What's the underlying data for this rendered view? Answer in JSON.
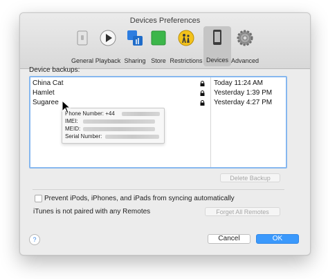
{
  "window": {
    "title": "Devices Preferences"
  },
  "toolbar": {
    "items": [
      {
        "label": "General",
        "icon": "general-icon",
        "active": false
      },
      {
        "label": "Playback",
        "icon": "play-icon",
        "active": false
      },
      {
        "label": "Sharing",
        "icon": "sharing-icon",
        "active": false
      },
      {
        "label": "Store",
        "icon": "store-icon",
        "active": false
      },
      {
        "label": "Restrictions",
        "icon": "restrictions-icon",
        "active": false
      },
      {
        "label": "Devices",
        "icon": "device-icon",
        "active": true
      },
      {
        "label": "Advanced",
        "icon": "gear-icon",
        "active": false
      }
    ]
  },
  "backups": {
    "label": "Device backups:",
    "rows": [
      {
        "name": "China Cat",
        "date": "Today 11:24 AM",
        "locked": true
      },
      {
        "name": "Hamlet",
        "date": "Yesterday 1:39 PM",
        "locked": true
      },
      {
        "name": "Sugaree",
        "date": "Yesterday 4:27 PM",
        "locked": true
      }
    ],
    "delete_button": "Delete Backup"
  },
  "tooltip": {
    "phone_label": "Phone Number: +44",
    "imei_label": "IMEI:",
    "meid_label": "MEID:",
    "serial_label": "Serial Number:"
  },
  "options": {
    "prevent_sync_label": "Prevent iPods, iPhones, and iPads from syncing automatically",
    "prevent_sync_checked": false,
    "remotes_status": "iTunes is not paired with any Remotes",
    "forget_remotes_button": "Forget All Remotes"
  },
  "footer": {
    "help": "?",
    "cancel": "Cancel",
    "ok": "OK"
  },
  "colors": {
    "accent": "#3b99fc",
    "selection_border": "#86b7ef"
  }
}
